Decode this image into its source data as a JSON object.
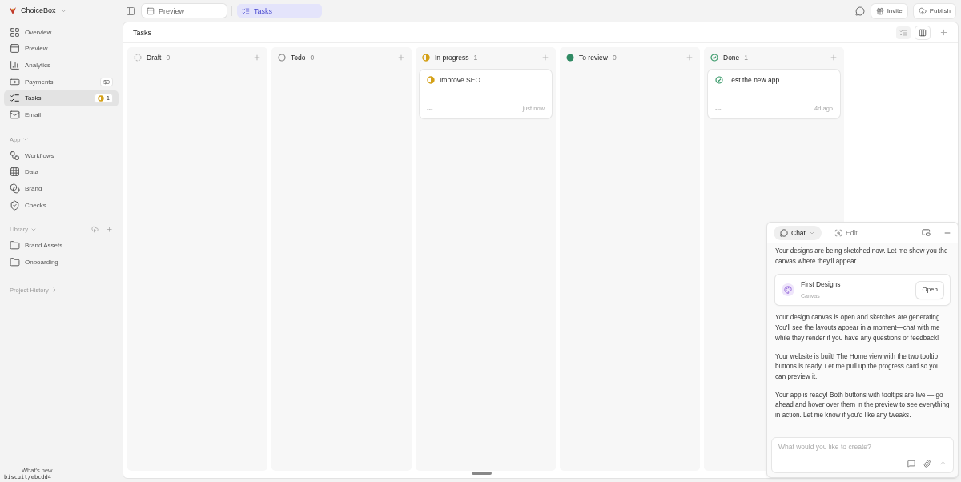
{
  "app": {
    "name": "ChoiceBox"
  },
  "sidebar": {
    "items": [
      {
        "kind": "overview",
        "label": "Overview",
        "selected": false
      },
      {
        "kind": "preview",
        "label": "Preview",
        "selected": false
      },
      {
        "kind": "analytics",
        "label": "Analytics",
        "selected": false
      },
      {
        "kind": "payments",
        "label": "Payments",
        "selected": false,
        "badge": {
          "text": "$0"
        }
      },
      {
        "kind": "tasks",
        "label": "Tasks",
        "selected": true,
        "badge": {
          "kind": "in_progress",
          "text": "1"
        }
      },
      {
        "kind": "email",
        "label": "Email",
        "selected": false
      }
    ],
    "sections": [
      {
        "title": "App",
        "items": [
          {
            "kind": "workflows",
            "label": "Workflows",
            "selected": false
          },
          {
            "kind": "data",
            "label": "Data",
            "selected": false
          },
          {
            "kind": "brand",
            "label": "Brand",
            "selected": false
          },
          {
            "kind": "checks",
            "label": "Checks",
            "selected": false
          }
        ]
      },
      {
        "title": "Library",
        "actions": [
          {
            "kind": "upload"
          },
          {
            "kind": "add"
          }
        ],
        "items": [
          {
            "kind": "folder",
            "label": "Brand Assets",
            "selected": false
          },
          {
            "kind": "folder",
            "label": "Onboarding",
            "selected": false
          }
        ]
      }
    ],
    "history": "Project History",
    "whats_new": "What's new",
    "branch": "biscuit/ebcdd4"
  },
  "tabs": [
    {
      "kind": "preview",
      "label": "Preview",
      "selected": false
    },
    {
      "kind": "tasks",
      "label": "Tasks",
      "selected": true
    }
  ],
  "top_actions": [
    {
      "kind": "gift",
      "label": "Invite"
    },
    {
      "kind": "upload",
      "label": "Publish"
    }
  ],
  "board": {
    "title": "Tasks",
    "view_modes": [
      {
        "kind": "list",
        "selected": false
      },
      {
        "kind": "board",
        "selected": true
      }
    ],
    "columns": [
      {
        "kind": "draft",
        "title": "Draft",
        "count": "0"
      },
      {
        "kind": "todo",
        "title": "Todo",
        "count": "0"
      },
      {
        "kind": "in_progress",
        "title": "In progress",
        "count": "1",
        "cards": [
          {
            "title": "Improve SEO",
            "meta": "---",
            "time": "just now"
          }
        ]
      },
      {
        "kind": "review",
        "title": "To review",
        "count": "0"
      },
      {
        "kind": "done",
        "title": "Done",
        "count": "1",
        "cards": [
          {
            "title": "Test the new app",
            "meta": "---",
            "time": "4d ago"
          }
        ]
      }
    ]
  },
  "chat": {
    "tabs": [
      {
        "kind": "chat",
        "label": "Chat",
        "selected": true
      },
      {
        "kind": "edit",
        "label": "Edit",
        "selected": false
      }
    ],
    "messages": [
      {
        "kind": "text",
        "text": "Your designs are being sketched now. Let me show you the canvas where they'll appear."
      },
      {
        "kind": "attachment",
        "title": "First Designs",
        "subtitle": "Canvas",
        "action": "Open"
      },
      {
        "kind": "text",
        "text": "Your design canvas is open and sketches are generating. You'll see the layouts appear in a moment—chat with me while they render if you have any questions or feedback!"
      },
      {
        "kind": "text",
        "text": "Your website is built! The Home view with the two tooltip buttons is ready. Let me pull up the progress card so you can preview it."
      },
      {
        "kind": "text",
        "text": "Your app is ready! Both buttons with tooltips are live — go ahead and hover over them in the preview to see everything in action. Let me know if you'd like any tweaks."
      }
    ],
    "input": {
      "placeholder": "What would you like to create?"
    }
  }
}
